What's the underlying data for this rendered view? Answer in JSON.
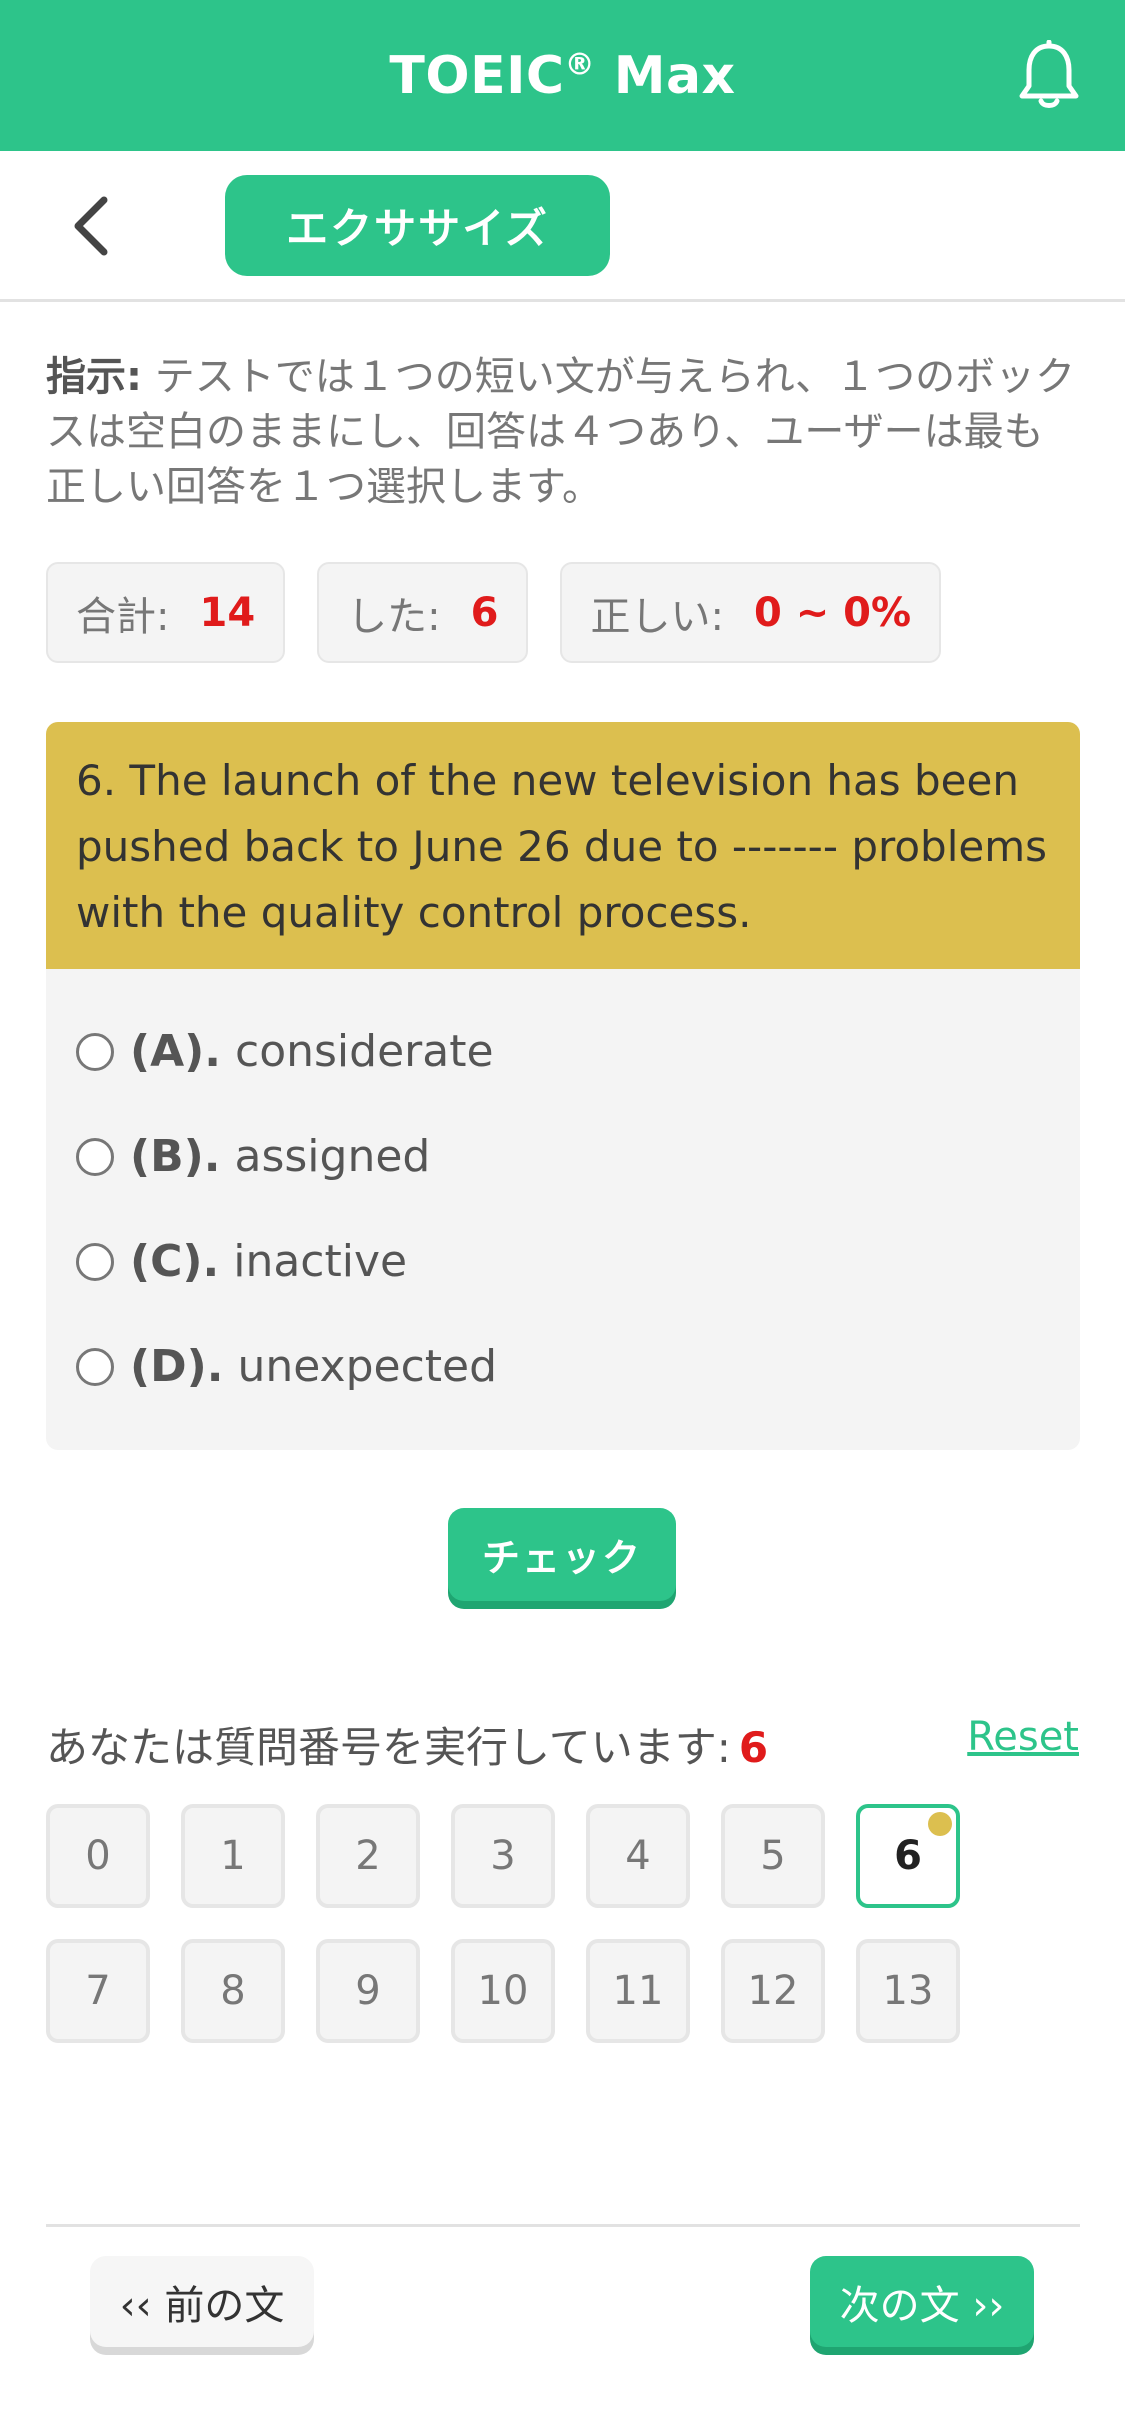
{
  "header": {
    "title": "TOEIC",
    "trademark": "®",
    "title_suffix": " Max",
    "notification_icon": "bell-icon"
  },
  "toolbar": {
    "back_icon": "chevron-left-icon",
    "tab_label": "エクササイズ"
  },
  "instructions": {
    "label": "指示:",
    "text": " テストでは１つの短い文が与えられ、１つのボックスは空白のままにし、回答は４つあり、ユーザーは最も正しい回答を１つ選択します。"
  },
  "stats": {
    "total_label": "合計:",
    "total_value": "14",
    "done_label": "した:",
    "done_value": "6",
    "correct_label": "正しい:",
    "correct_value": "0 ~ 0%"
  },
  "question": {
    "text": "6. The launch of the new television has been pushed back to June 26 due to ------- problems with the quality control process.",
    "options": [
      {
        "letter": "(A).",
        "text": "considerate"
      },
      {
        "letter": "(B).",
        "text": "assigned"
      },
      {
        "letter": "(C).",
        "text": "inactive"
      },
      {
        "letter": "(D).",
        "text": "unexpected"
      }
    ]
  },
  "check_button": "チェック",
  "progress": {
    "label": "あなたは質問番号を実行しています:",
    "current": "6",
    "reset_label": "Reset",
    "numbers": [
      "0",
      "1",
      "2",
      "3",
      "4",
      "5",
      "6",
      "7",
      "8",
      "9",
      "10",
      "11",
      "12",
      "13"
    ]
  },
  "nav": {
    "prev_label": "‹‹ 前の文",
    "next_label": "次の文 ››"
  },
  "colors": {
    "accent": "#2dc48a",
    "question_bg": "#dcbf4f",
    "highlight": "#e01b1b"
  }
}
